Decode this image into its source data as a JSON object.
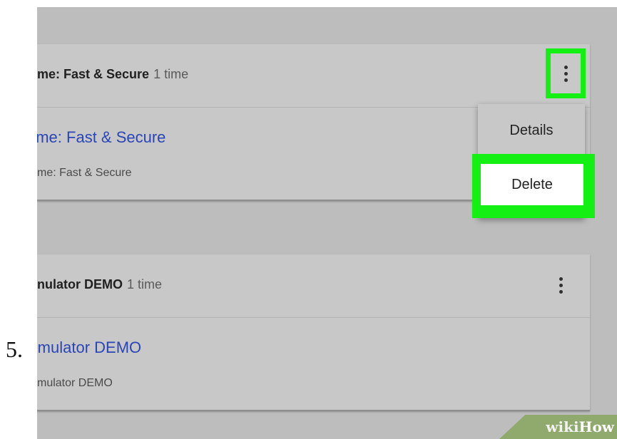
{
  "step": "5.",
  "cards": [
    {
      "title": "me: Fast & Secure",
      "count": "1 time",
      "link": "ome: Fast & Secure",
      "subtitle": "me: Fast & Secure"
    },
    {
      "title": "nulator DEMO",
      "count": "1 time",
      "link": "Emulator DEMO",
      "subtitle": "mulator DEMO"
    }
  ],
  "menu": {
    "details": "Details",
    "delete": "Delete"
  },
  "watermark": {
    "wiki": "wiki",
    "how": "How"
  },
  "colors": {
    "highlight": "#14ef14",
    "link": "#2a45b5",
    "background": "#bdbdbd",
    "card": "#c8c8c8"
  },
  "icons": {
    "more": "more-vert-icon"
  }
}
